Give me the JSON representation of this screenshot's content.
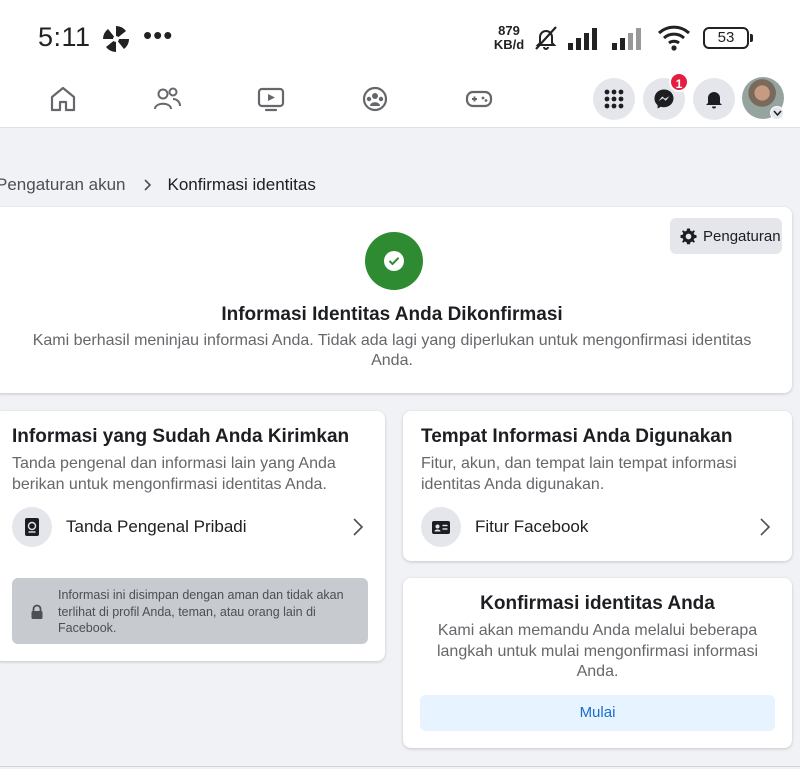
{
  "status_bar": {
    "time": "5:11",
    "more": "•••",
    "net_speed_value": "879",
    "net_speed_unit": "KB/d",
    "battery": "53"
  },
  "nav": {
    "messenger_badge": "1"
  },
  "breadcrumb": {
    "parent": "Pengaturan akun",
    "current": "Konfirmasi identitas"
  },
  "confirmed_card": {
    "settings_label": "Pengaturan",
    "title": "Informasi Identitas Anda Dikonfirmasi",
    "description": "Kami berhasil meninjau informasi Anda. Tidak ada lagi yang diperlukan untuk mengonfirmasi identitas Anda."
  },
  "submitted_card": {
    "title": "Informasi yang Sudah Anda Kirimkan",
    "description": "Tanda pengenal dan informasi lain yang Anda berikan untuk mengonfirmasi identitas Anda.",
    "item_label": "Tanda Pengenal Pribadi",
    "privacy_note": "Informasi ini disimpan dengan aman dan tidak akan terlihat di profil Anda, teman, atau orang lain di Facebook."
  },
  "usage_card": {
    "title": "Tempat Informasi Anda Digunakan",
    "description": "Fitur, akun, dan tempat lain tempat informasi identitas Anda digunakan.",
    "item_label": "Fitur Facebook"
  },
  "confirm_card": {
    "title": "Konfirmasi identitas Anda",
    "description": "Kami akan memandu Anda melalui beberapa langkah untuk mulai mengonfirmasi informasi Anda.",
    "button_label": "Mulai"
  },
  "colors": {
    "accent_blue": "#1a6ccf",
    "success_green": "#2e8b32",
    "badge_red": "#e41e3f",
    "page_bg": "#f0f2f5"
  }
}
